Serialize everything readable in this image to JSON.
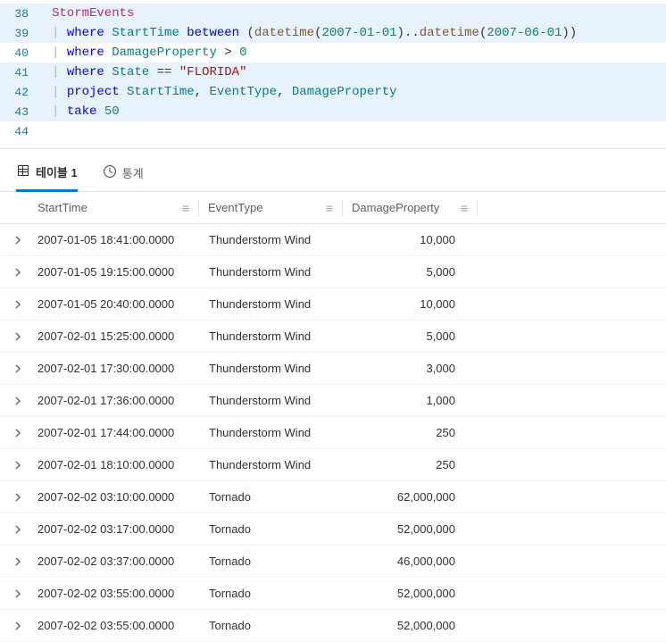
{
  "editor": {
    "lines": [
      {
        "num": "38",
        "hl": true,
        "tokens": [
          {
            "t": "StormEvents",
            "c": "c-ident"
          }
        ]
      },
      {
        "num": "39",
        "hl": true,
        "tokens": [
          {
            "t": "| ",
            "c": "c-pipe"
          },
          {
            "t": "where ",
            "c": "c-kw"
          },
          {
            "t": "StartTime ",
            "c": "c-col"
          },
          {
            "t": "between ",
            "c": "c-kw"
          },
          {
            "t": "(",
            "c": "c-paren"
          },
          {
            "t": "datetime",
            "c": "c-fn"
          },
          {
            "t": "(",
            "c": "c-paren"
          },
          {
            "t": "2007-01-01",
            "c": "c-num"
          },
          {
            "t": ")",
            "c": "c-paren"
          },
          {
            "t": "..",
            "c": "c-op"
          },
          {
            "t": "datetime",
            "c": "c-fn"
          },
          {
            "t": "(",
            "c": "c-paren"
          },
          {
            "t": "2007-06-01",
            "c": "c-num"
          },
          {
            "t": ")",
            "c": "c-paren"
          },
          {
            "t": ")",
            "c": "c-paren"
          }
        ]
      },
      {
        "num": "40",
        "hl": false,
        "tokens": [
          {
            "t": "| ",
            "c": "c-pipe"
          },
          {
            "t": "where ",
            "c": "c-kw"
          },
          {
            "t": "DamageProperty ",
            "c": "c-col"
          },
          {
            "t": "> ",
            "c": "c-op"
          },
          {
            "t": "0",
            "c": "c-num"
          }
        ]
      },
      {
        "num": "41",
        "hl": true,
        "tokens": [
          {
            "t": "| ",
            "c": "c-pipe"
          },
          {
            "t": "where ",
            "c": "c-kw"
          },
          {
            "t": "State ",
            "c": "c-col"
          },
          {
            "t": "== ",
            "c": "c-op"
          },
          {
            "t": "\"FLORIDA\"",
            "c": "c-str"
          }
        ]
      },
      {
        "num": "42",
        "hl": true,
        "tokens": [
          {
            "t": "| ",
            "c": "c-pipe"
          },
          {
            "t": "project ",
            "c": "c-kw"
          },
          {
            "t": "StartTime",
            "c": "c-col"
          },
          {
            "t": ", ",
            "c": "c-comma"
          },
          {
            "t": "EventType",
            "c": "c-col"
          },
          {
            "t": ", ",
            "c": "c-comma"
          },
          {
            "t": "DamageProperty",
            "c": "c-col"
          }
        ]
      },
      {
        "num": "43",
        "hl": true,
        "tokens": [
          {
            "t": "| ",
            "c": "c-pipe"
          },
          {
            "t": "take ",
            "c": "c-kw"
          },
          {
            "t": "50",
            "c": "c-num"
          }
        ]
      },
      {
        "num": "44",
        "hl": false,
        "tokens": []
      }
    ]
  },
  "tabs": {
    "table_label": "테이블 1",
    "stats_label": "통계"
  },
  "grid": {
    "headers": {
      "start": "StartTime",
      "event": "EventType",
      "damage": "DamageProperty"
    },
    "menu_glyph": "≡",
    "rows": [
      {
        "start": "2007-01-05 18:41:00.0000",
        "event": "Thunderstorm Wind",
        "damage": "10,000"
      },
      {
        "start": "2007-01-05 19:15:00.0000",
        "event": "Thunderstorm Wind",
        "damage": "5,000"
      },
      {
        "start": "2007-01-05 20:40:00.0000",
        "event": "Thunderstorm Wind",
        "damage": "10,000"
      },
      {
        "start": "2007-02-01 15:25:00.0000",
        "event": "Thunderstorm Wind",
        "damage": "5,000"
      },
      {
        "start": "2007-02-01 17:30:00.0000",
        "event": "Thunderstorm Wind",
        "damage": "3,000"
      },
      {
        "start": "2007-02-01 17:36:00.0000",
        "event": "Thunderstorm Wind",
        "damage": "1,000"
      },
      {
        "start": "2007-02-01 17:44:00.0000",
        "event": "Thunderstorm Wind",
        "damage": "250"
      },
      {
        "start": "2007-02-01 18:10:00.0000",
        "event": "Thunderstorm Wind",
        "damage": "250"
      },
      {
        "start": "2007-02-02 03:10:00.0000",
        "event": "Tornado",
        "damage": "62,000,000"
      },
      {
        "start": "2007-02-02 03:17:00.0000",
        "event": "Tornado",
        "damage": "52,000,000"
      },
      {
        "start": "2007-02-02 03:37:00.0000",
        "event": "Tornado",
        "damage": "46,000,000"
      },
      {
        "start": "2007-02-02 03:55:00.0000",
        "event": "Tornado",
        "damage": "52,000,000"
      },
      {
        "start": "2007-02-02 03:55:00.0000",
        "event": "Tornado",
        "damage": "52,000,000"
      }
    ]
  }
}
